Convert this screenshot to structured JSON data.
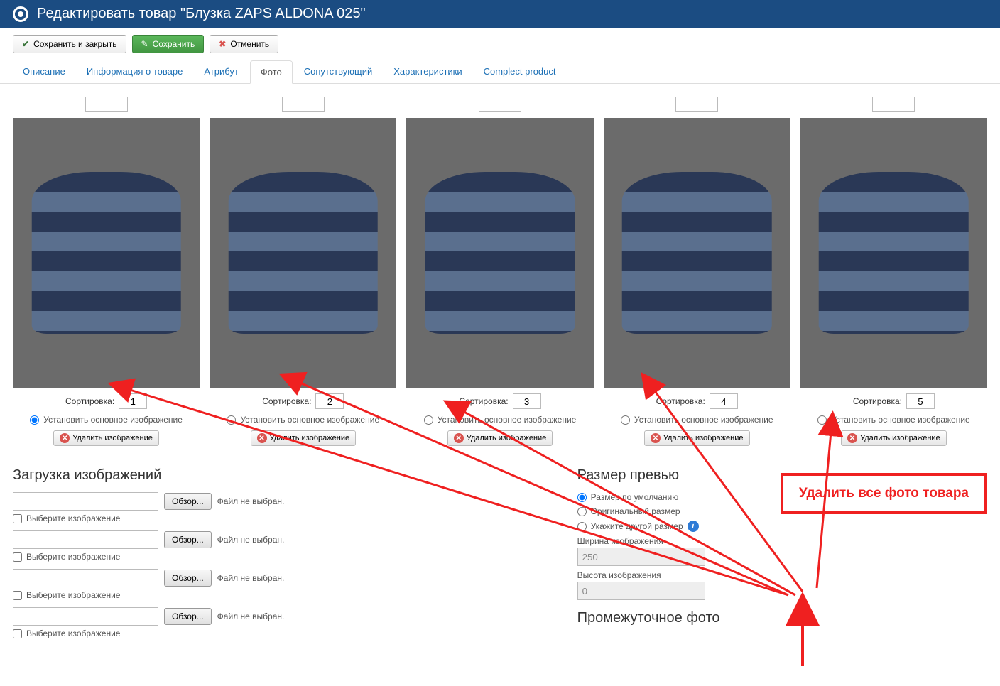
{
  "header": {
    "title": "Редактировать товар \"Блузка ZAPS ALDONA 025\""
  },
  "toolbar": {
    "save_close": "Сохранить и закрыть",
    "save": "Сохранить",
    "cancel": "Отменить"
  },
  "tabs": {
    "items": [
      {
        "label": "Описание"
      },
      {
        "label": "Информация о товаре"
      },
      {
        "label": "Атрибут"
      },
      {
        "label": "Фото",
        "active": true
      },
      {
        "label": "Сопутствующий"
      },
      {
        "label": "Характеристики"
      },
      {
        "label": "Complect product"
      }
    ]
  },
  "photos": {
    "sort_label": "Сортировка:",
    "set_main_label": "Установить основное изображение",
    "delete_label": "Удалить изображение",
    "items": [
      {
        "sort": "1"
      },
      {
        "sort": "2"
      },
      {
        "sort": "3"
      },
      {
        "sort": "4"
      },
      {
        "sort": "5"
      }
    ]
  },
  "upload": {
    "heading": "Загрузка изображений",
    "browse": "Обзор...",
    "no_file": "Файл не выбран.",
    "select_label": "Выберите изображение"
  },
  "preview": {
    "heading": "Размер превью",
    "opt_default": "Размер по умолчанию",
    "opt_original": "Оригинальный размер",
    "opt_custom": "Укажите другой размер",
    "width_label": "Ширина изображения",
    "width_value": "250",
    "height_label": "Высота изображения",
    "height_value": "0",
    "intermediate_heading": "Промежуточное фото"
  },
  "highlight": {
    "text": "Удалить все фото товара"
  }
}
